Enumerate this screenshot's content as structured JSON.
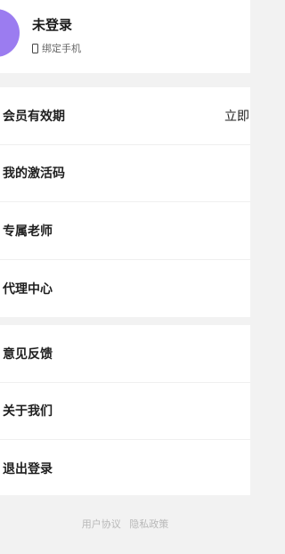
{
  "profile": {
    "status": "未登录",
    "bind_phone": "绑定手机",
    "avatar_color": "#9b7cf0"
  },
  "menu": {
    "group1": [
      {
        "label": "会员有效期",
        "value": "立即"
      },
      {
        "label": "我的激活码"
      },
      {
        "label": "专属老师"
      },
      {
        "label": "代理中心"
      }
    ],
    "group2": [
      {
        "label": "意见反馈"
      },
      {
        "label": "关于我们"
      },
      {
        "label": "退出登录"
      }
    ]
  },
  "footer": {
    "user_agreement": "用户协议",
    "privacy_policy": "隐私政策"
  },
  "icons": {
    "phone": "phone-icon"
  }
}
